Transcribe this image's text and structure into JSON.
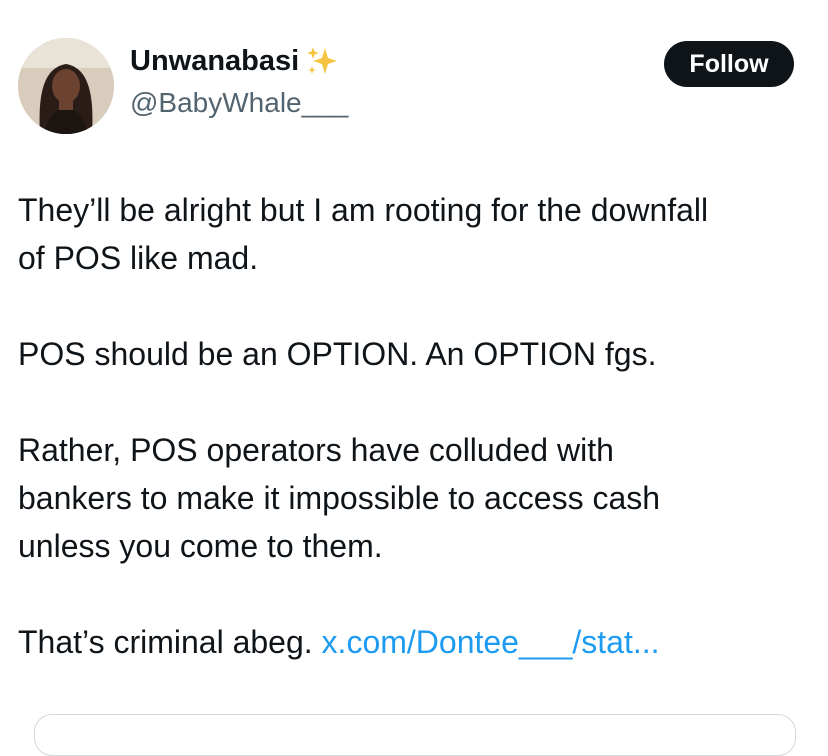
{
  "author": {
    "display_name": "Unwanabasi",
    "emoji_icon": "sparkles-icon",
    "handle": "@BabyWhale___",
    "avatar_icon": "profile-photo"
  },
  "actions": {
    "follow_label": "Follow"
  },
  "tweet": {
    "line1": "They’ll be alright but I am rooting for the downfall",
    "line2": "of POS like mad.",
    "para2": "POS should be an OPTION. An OPTION fgs.",
    "para3_line1": "Rather, POS operators have colluded with",
    "para3_line2": "bankers to make it impossible to access cash",
    "para3_line3": "unless you come to them.",
    "para4_text": "That’s criminal abeg. ",
    "para4_link": "x.com/Dontee___/stat..."
  },
  "colors": {
    "text": "#0f1419",
    "secondary": "#536471",
    "link": "#1d9bf0",
    "button_bg": "#0f1419",
    "sparkle": "#f5c542"
  }
}
